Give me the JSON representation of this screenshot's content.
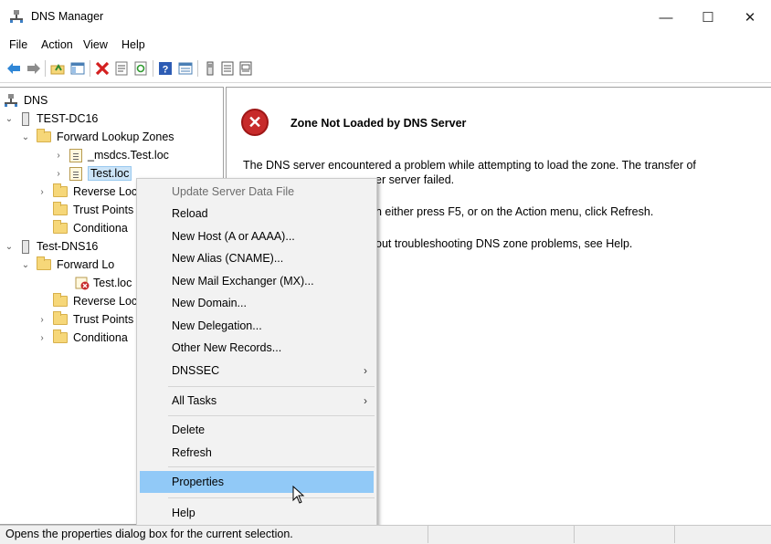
{
  "window": {
    "title": "DNS Manager",
    "minimize": "—",
    "maximize": "☐",
    "close": "✕"
  },
  "menubar": [
    "File",
    "Action",
    "View",
    "Help"
  ],
  "toolbar": [
    "back-icon",
    "forward-icon",
    "up-folder-icon",
    "show-hide-tree-icon",
    "delete-icon",
    "properties-icon",
    "refresh-icon",
    "help-icon",
    "view-icon",
    "server-icon",
    "zone-icon",
    "record-icon"
  ],
  "tree": {
    "root": "DNS",
    "server1": "TEST-DC16",
    "fwd1": "Forward Lookup Zones",
    "msdcs": "_msdcs.Test.loc",
    "testloc1": "Test.loc",
    "rev1": "Reverse Loc",
    "trust1": "Trust Points",
    "cond1": "Conditiona",
    "server2": "Test-DNS16",
    "fwd2": "Forward Lo",
    "testloc2": "Test.loc",
    "rev2": "Reverse Loc",
    "trust2": "Trust Points",
    "cond2": "Conditiona"
  },
  "details": {
    "title": "Zone Not Loaded by DNS Server",
    "line1": "The DNS server encountered a problem while attempting to load the zone. The transfer of",
    "line2": "er server failed.",
    "line3": "n either press F5, or on the Action menu, click Refresh.",
    "line4": "out troubleshooting DNS zone problems, see Help."
  },
  "context_menu": {
    "items": [
      {
        "label": "Update Server Data File",
        "disabled": true
      },
      {
        "label": "Reload"
      },
      {
        "label": "New Host (A or AAAA)..."
      },
      {
        "label": "New Alias (CNAME)..."
      },
      {
        "label": "New Mail Exchanger (MX)..."
      },
      {
        "label": "New Domain..."
      },
      {
        "label": "New Delegation..."
      },
      {
        "label": "Other New Records..."
      },
      {
        "label": "DNSSEC",
        "submenu": true
      },
      {
        "label": "All Tasks",
        "submenu": true
      },
      {
        "label": "Delete"
      },
      {
        "label": "Refresh"
      },
      {
        "label": "Properties",
        "highlighted": true
      },
      {
        "label": "Help"
      }
    ],
    "arrow": "›"
  },
  "status": {
    "text": "Opens the properties dialog box for the current selection."
  }
}
